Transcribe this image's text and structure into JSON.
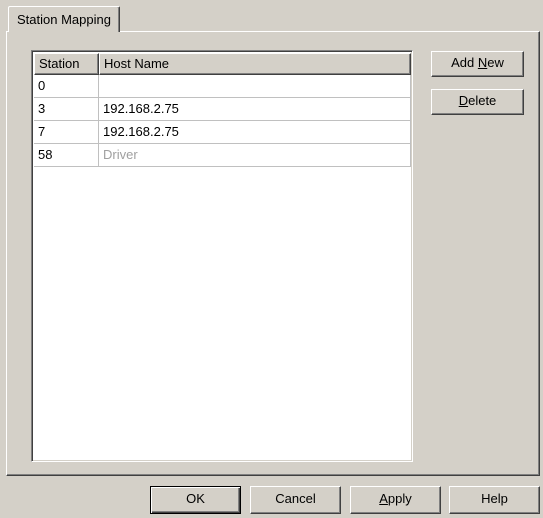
{
  "tab": {
    "label": "Station Mapping"
  },
  "list": {
    "columns": [
      "Station",
      "Host Name"
    ],
    "rows": [
      {
        "station": "0",
        "host": ""
      },
      {
        "station": "3",
        "host": "192.168.2.75"
      },
      {
        "station": "7",
        "host": "192.168.2.75"
      },
      {
        "station": "58",
        "host": "Driver"
      }
    ]
  },
  "side_buttons": {
    "add_new": {
      "pre": "Add ",
      "mnemonic": "N",
      "post": "ew"
    },
    "delete": {
      "pre": "",
      "mnemonic": "D",
      "post": "elete"
    }
  },
  "footer_buttons": {
    "ok": "OK",
    "cancel": "Cancel",
    "apply": {
      "pre": "",
      "mnemonic": "A",
      "post": "pply"
    },
    "help": "Help"
  },
  "colors": {
    "face": "#d4d0c8",
    "muted_text": "#a0a0a0"
  }
}
